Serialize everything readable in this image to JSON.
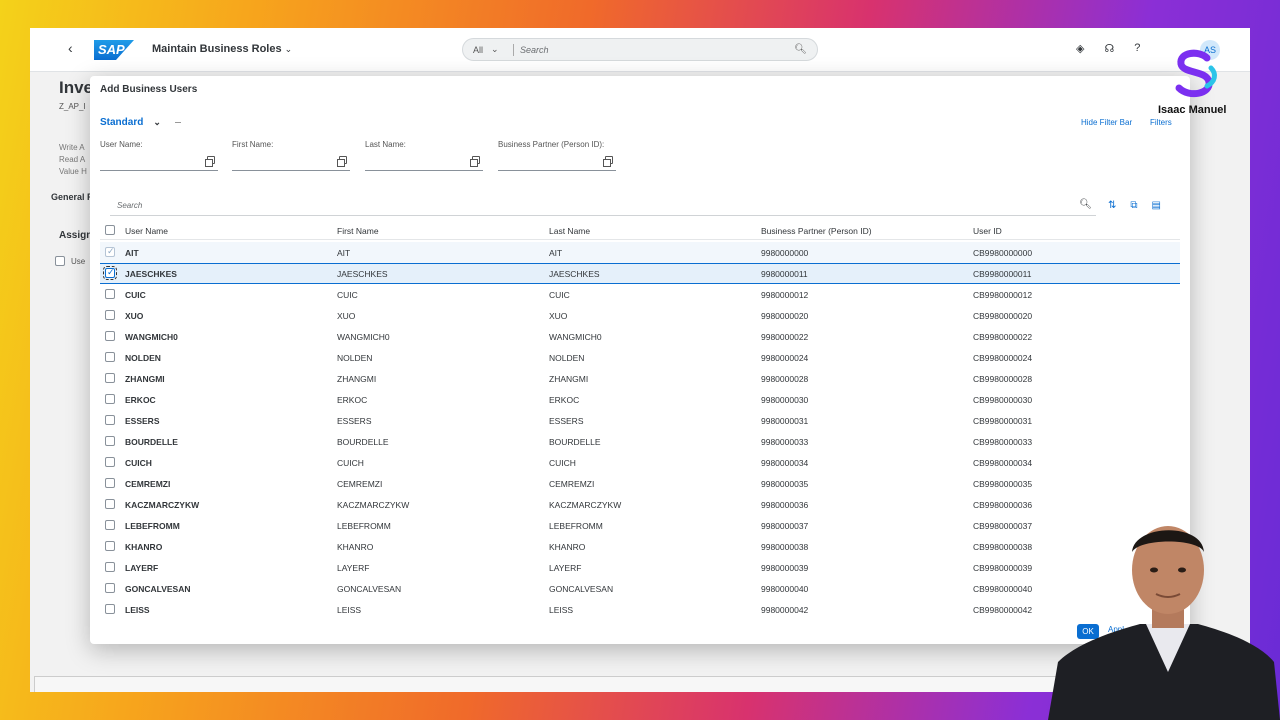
{
  "shell": {
    "app_title": "Maintain Business Roles",
    "search_scope": "All",
    "search_placeholder": "Search",
    "avatar_initials": "AS"
  },
  "background_page": {
    "title": "Inve",
    "subtitle": "Z_AP_I",
    "lines": [
      "Write A",
      "Read A",
      "Value H"
    ],
    "tab": "General F",
    "section": "Assign",
    "col_fragment": "Use"
  },
  "dialog": {
    "title": "Add Business Users",
    "variant": "Standard",
    "hide_filter_bar": "Hide Filter Bar",
    "filters": "Filters",
    "filter_fields": [
      {
        "label": "User Name:",
        "value": ""
      },
      {
        "label": "First Name:",
        "value": ""
      },
      {
        "label": "Last Name:",
        "value": ""
      },
      {
        "label": "Business Partner (Person ID):",
        "value": ""
      }
    ],
    "table_search_placeholder": "Search",
    "columns": [
      "User Name",
      "First Name",
      "Last Name",
      "Business Partner (Person ID)",
      "User ID"
    ],
    "rows": [
      {
        "user": "AIT",
        "first": "AIT",
        "last": "AIT",
        "bp": "9980000000",
        "uid": "CB9980000000",
        "checked": true
      },
      {
        "user": "JAESCHKES",
        "first": "JAESCHKES",
        "last": "JAESCHKES",
        "bp": "9980000011",
        "uid": "CB9980000011",
        "checked": true
      },
      {
        "user": "CUIC",
        "first": "CUIC",
        "last": "CUIC",
        "bp": "9980000012",
        "uid": "CB9980000012",
        "checked": false
      },
      {
        "user": "XUO",
        "first": "XUO",
        "last": "XUO",
        "bp": "9980000020",
        "uid": "CB9980000020",
        "checked": false
      },
      {
        "user": "WANGMICH0",
        "first": "WANGMICH0",
        "last": "WANGMICH0",
        "bp": "9980000022",
        "uid": "CB9980000022",
        "checked": false
      },
      {
        "user": "NOLDEN",
        "first": "NOLDEN",
        "last": "NOLDEN",
        "bp": "9980000024",
        "uid": "CB9980000024",
        "checked": false
      },
      {
        "user": "ZHANGMI",
        "first": "ZHANGMI",
        "last": "ZHANGMI",
        "bp": "9980000028",
        "uid": "CB9980000028",
        "checked": false
      },
      {
        "user": "ERKOC",
        "first": "ERKOC",
        "last": "ERKOC",
        "bp": "9980000030",
        "uid": "CB9980000030",
        "checked": false
      },
      {
        "user": "ESSERS",
        "first": "ESSERS",
        "last": "ESSERS",
        "bp": "9980000031",
        "uid": "CB9980000031",
        "checked": false
      },
      {
        "user": "BOURDELLE",
        "first": "BOURDELLE",
        "last": "BOURDELLE",
        "bp": "9980000033",
        "uid": "CB9980000033",
        "checked": false
      },
      {
        "user": "CUICH",
        "first": "CUICH",
        "last": "CUICH",
        "bp": "9980000034",
        "uid": "CB9980000034",
        "checked": false
      },
      {
        "user": "CEMREMZI",
        "first": "CEMREMZI",
        "last": "CEMREMZI",
        "bp": "9980000035",
        "uid": "CB9980000035",
        "checked": false
      },
      {
        "user": "KACZMARCZYKW",
        "first": "KACZMARCZYKW",
        "last": "KACZMARCZYKW",
        "bp": "9980000036",
        "uid": "CB9980000036",
        "checked": false
      },
      {
        "user": "LEBEFROMM",
        "first": "LEBEFROMM",
        "last": "LEBEFROMM",
        "bp": "9980000037",
        "uid": "CB9980000037",
        "checked": false
      },
      {
        "user": "KHANRO",
        "first": "KHANRO",
        "last": "KHANRO",
        "bp": "9980000038",
        "uid": "CB9980000038",
        "checked": false
      },
      {
        "user": "LAYERF",
        "first": "LAYERF",
        "last": "LAYERF",
        "bp": "9980000039",
        "uid": "CB9980000039",
        "checked": false
      },
      {
        "user": "GONCALVESAN",
        "first": "GONCALVESAN",
        "last": "GONCALVESAN",
        "bp": "9980000040",
        "uid": "CB9980000040",
        "checked": false
      },
      {
        "user": "LEISS",
        "first": "LEISS",
        "last": "LEISS",
        "bp": "9980000042",
        "uid": "CB9980000042",
        "checked": false
      }
    ],
    "ok_label": "OK",
    "apply_label": "Appl"
  },
  "overlay": {
    "brand_name": "Isaac Manuel"
  },
  "colors": {
    "accent": "#0a6ed1",
    "brand_purple": "#7b2ff0",
    "brand_cyan": "#2bc4e8"
  }
}
